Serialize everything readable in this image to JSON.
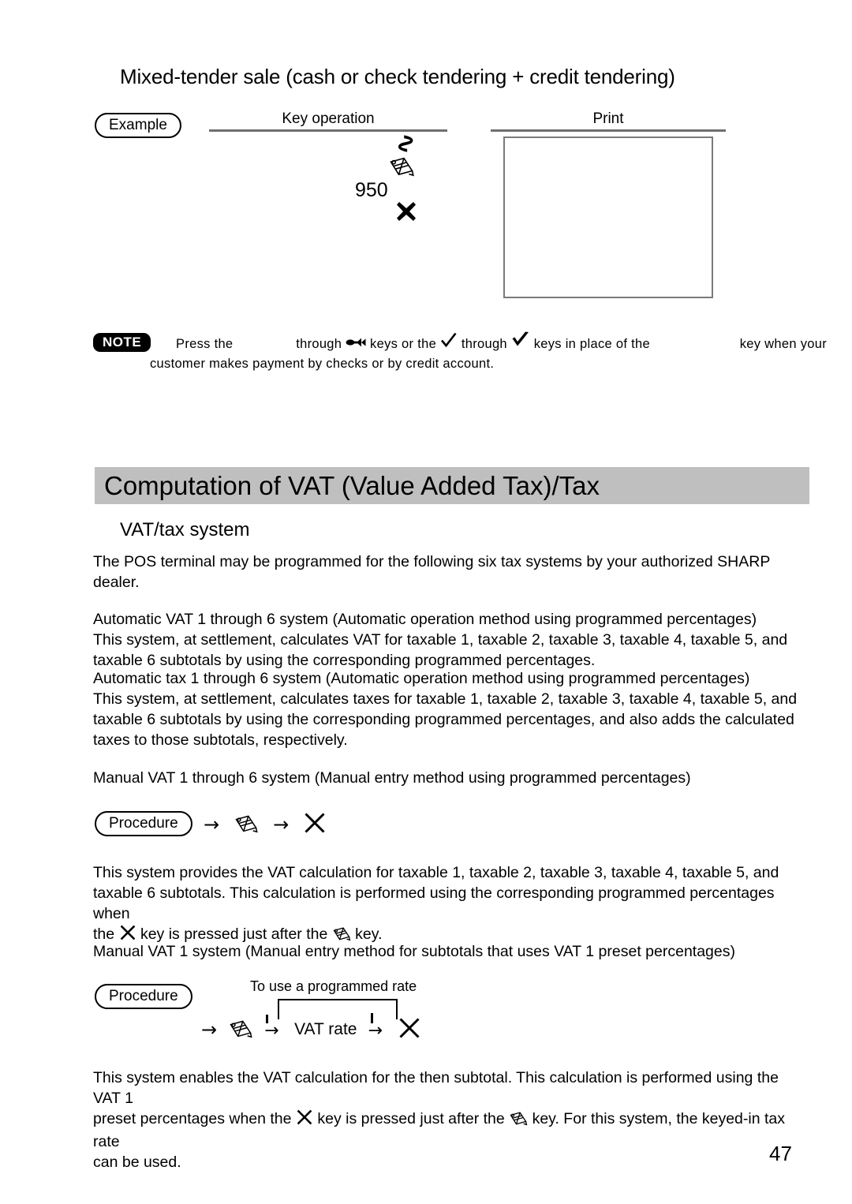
{
  "document": {
    "page_number": "47",
    "accent_banner_color": "#bfbfbf",
    "rule_color": "#6f6f6f"
  },
  "section_mixed_tender": {
    "title": "Mixed-tender sale (cash or check tendering + credit tendering)",
    "example_label": "Example",
    "key_operation_header": "Key operation",
    "print_header": "Print",
    "key_operation": {
      "continuation_mark": "~",
      "pencil_icon": "pencil-key-icon",
      "amount": "950",
      "multiply_icon": "bold-x-key-icon"
    },
    "print_output": ""
  },
  "note": {
    "badge": "NOTE",
    "line1_part1": "Press the",
    "line1_key1": "",
    "line1_part2": "through",
    "line1_icon1": "●➜",
    "line1_part3": "keys or the",
    "line1_icon2": "✓",
    "line1_part4": "through",
    "line1_icon3": "✔",
    "line1_part5": "keys in place of the",
    "line1_key2": "",
    "line1_part6": "key when your",
    "line2": "customer makes payment by checks or by credit account."
  },
  "section_vat": {
    "banner_title": "Computation of VAT (Value Added Tax)/Tax",
    "subheading": "VAT/tax system",
    "intro": "The POS terminal may be programmed for the following six tax systems by your authorized SHARP dealer.",
    "auto_vat_heading": "Automatic VAT 1 through 6 system (Automatic operation method using programmed percentages)",
    "auto_vat_body_line1": "This system, at settlement, calculates VAT for taxable 1, taxable 2, taxable 3, taxable 4, taxable 5, and",
    "auto_vat_body_line2": "taxable 6 subtotals by using the corresponding programmed percentages.",
    "auto_tax_heading": "Automatic tax 1 through 6 system (Automatic operation method using programmed percentages)",
    "auto_tax_body_line1": "This system, at settlement, calculates taxes for taxable 1, taxable 2, taxable 3, taxable 4, taxable 5, and",
    "auto_tax_body_line2": "taxable 6 subtotals by using the corresponding programmed percentages, and also adds the calculated",
    "auto_tax_body_line3": "taxes to those subtotals, respectively.",
    "manual_vat6_heading": "Manual VAT 1 through 6 system (Manual entry method using programmed percentages)",
    "procedure_label": "Procedure",
    "procedure1": {
      "arrow1": "→",
      "pencil_icon": "pencil-key-icon",
      "arrow2": "→",
      "x_icon": "x-key-icon"
    },
    "manual_vat6_body_line1": "This system provides the VAT calculation for taxable 1, taxable 2, taxable 3, taxable 4, taxable 5, and",
    "manual_vat6_body_line2": "taxable 6 subtotals. This calculation is performed using the corresponding programmed percentages when",
    "manual_vat6_body_line3_a": "the",
    "manual_vat6_body_line3_b": "key is pressed just after the",
    "manual_vat6_body_line3_c": "key.",
    "manual_vat1_heading": "Manual VAT 1 system (Manual entry method for subtotals that uses VAT 1 preset percentages)",
    "procedure2": {
      "bypass_label": "To use a programmed rate",
      "arrow1": "→",
      "pencil_icon": "pencil-key-icon",
      "arrow2": "→",
      "vat_rate_label": "VAT rate",
      "arrow3": "→",
      "x_icon": "x-key-icon"
    },
    "manual_vat1_body_line1": "This system enables the VAT calculation for the then subtotal. This calculation is performed using the VAT 1",
    "manual_vat1_body_line2_a": "preset percentages when the",
    "manual_vat1_body_line2_b": "key is pressed just after the",
    "manual_vat1_body_line2_c": "key. For this system, the keyed-in tax rate",
    "manual_vat1_body_line3": "can be used."
  }
}
